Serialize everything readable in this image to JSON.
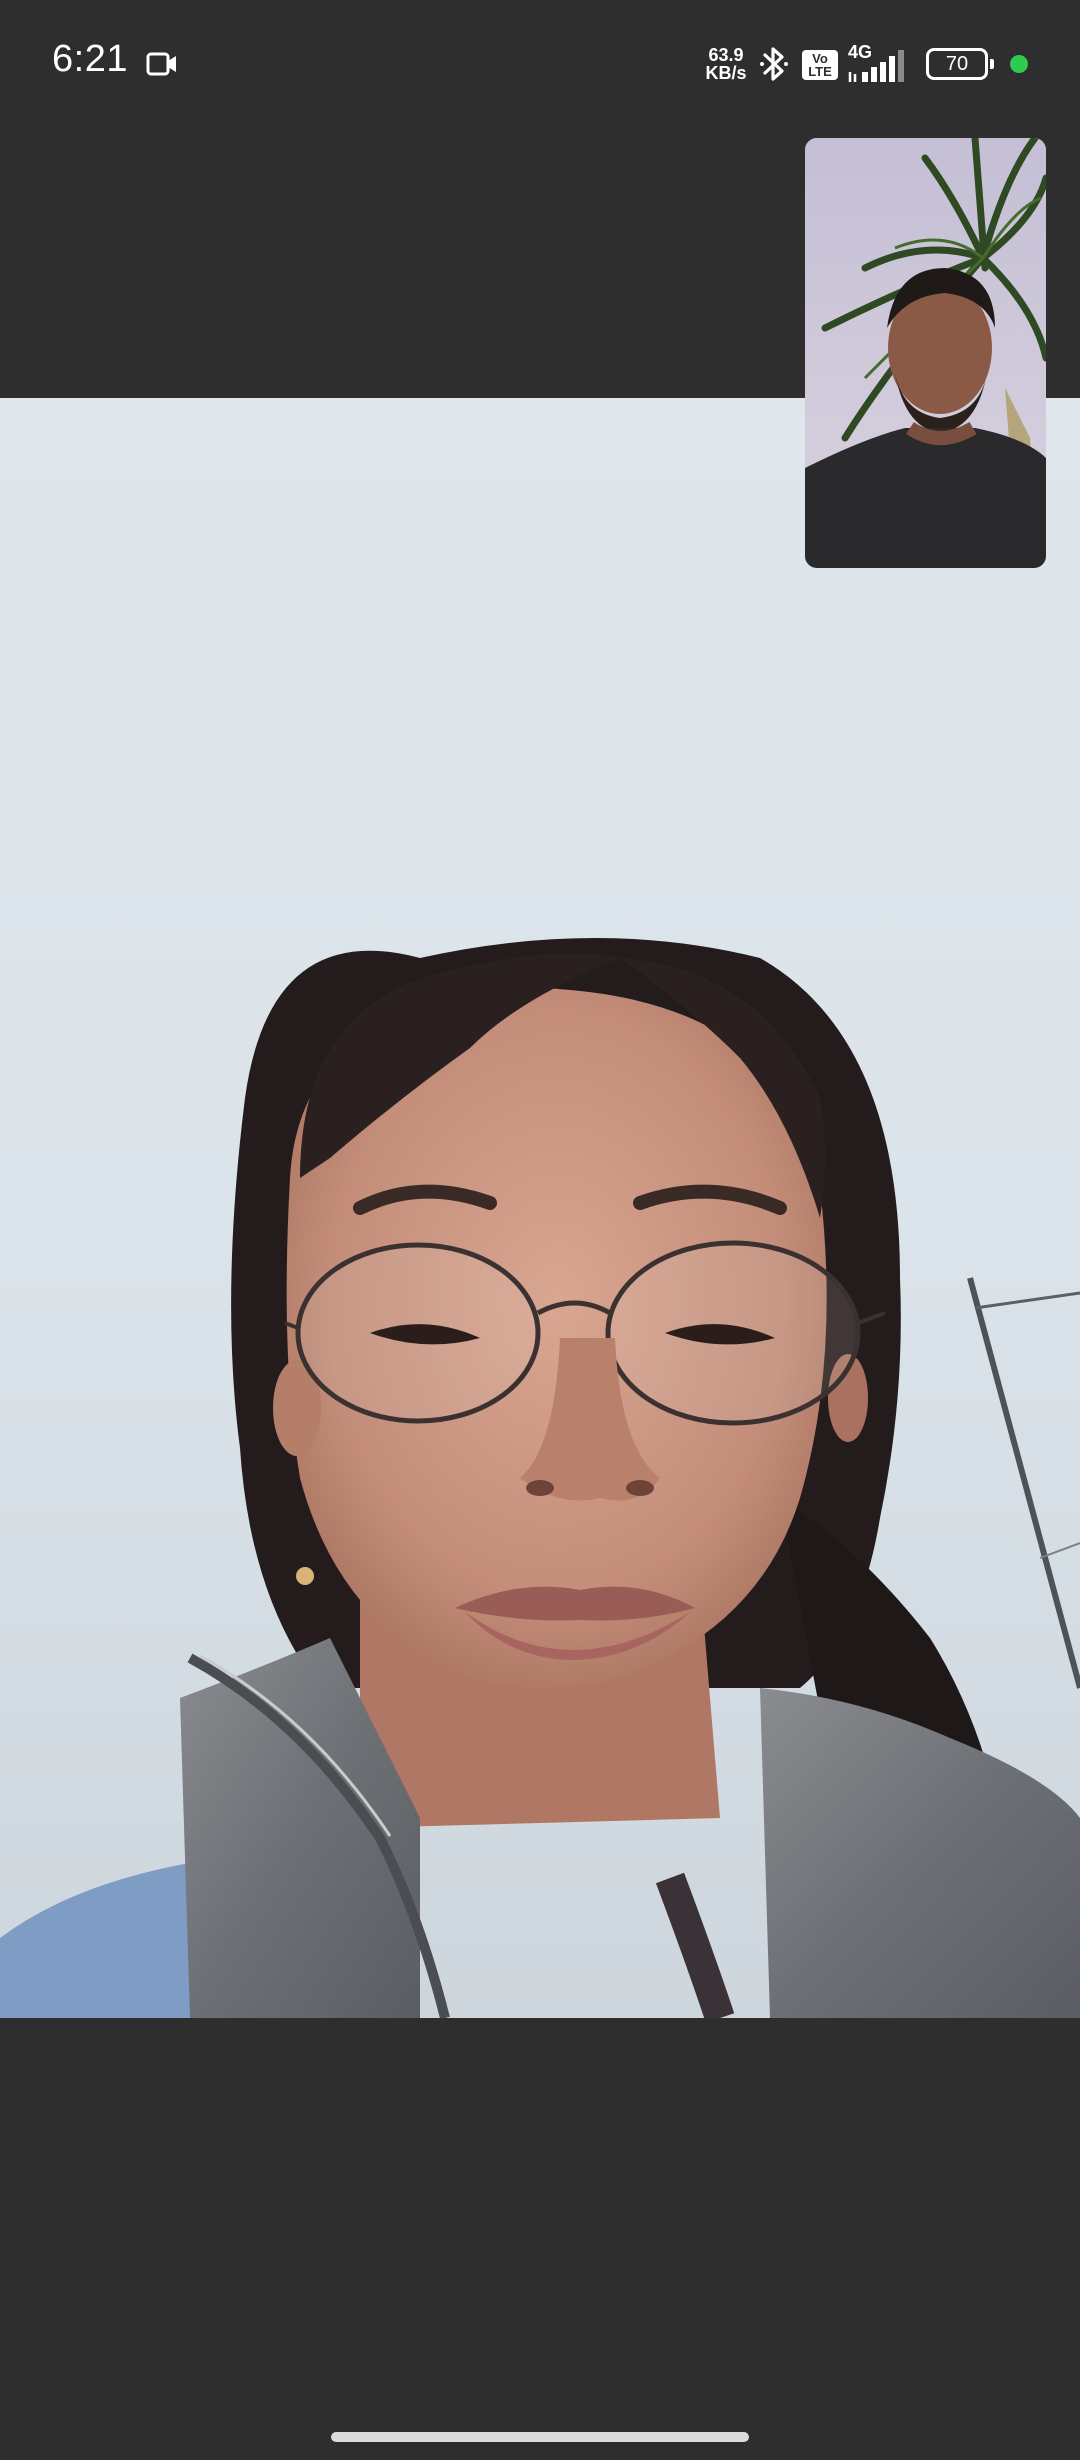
{
  "status_bar": {
    "time": "6:21",
    "net_speed_value": "63.9",
    "net_speed_unit": "KB/s",
    "volte_top": "Vo",
    "volte_bottom": "LTE",
    "network_type": "4G",
    "battery_level": "70",
    "active_indicator_color": "#2ecc4e",
    "icons": [
      "video-camera-icon",
      "bluetooth-icon",
      "volte-icon",
      "signal-icon",
      "battery-icon"
    ]
  },
  "call": {
    "remote_video": "remote participant video feed",
    "self_view": "self camera preview"
  },
  "colors": {
    "background": "#2e2e2e",
    "sky": "#dde4ea",
    "home_indicator": "#dcdcdc"
  }
}
